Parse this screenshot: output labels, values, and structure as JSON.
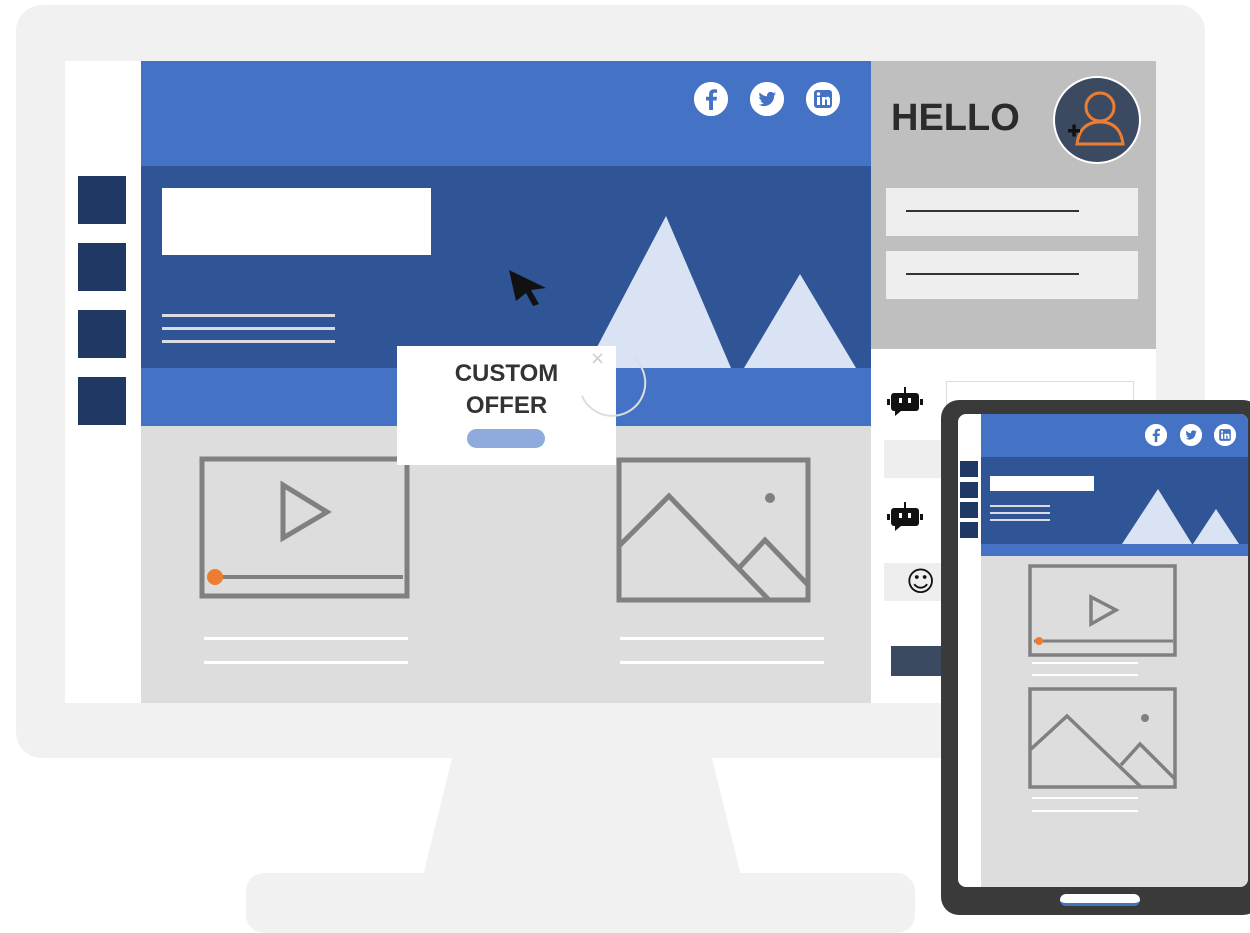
{
  "hero": {
    "social_icons": [
      "facebook-icon",
      "twitter-icon",
      "linkedin-icon"
    ]
  },
  "profile": {
    "greeting": "HELLO",
    "avatar_icon": "user-add-icon"
  },
  "popup": {
    "title": "CUSTOM\nOFFER",
    "close_symbol": "×"
  },
  "chat": {
    "bot_icon": "chatbot-icon",
    "emoji_icon": "smiley-icon",
    "emoji_symbol": "☺"
  },
  "colors": {
    "primary": "#4472c4",
    "dark_primary": "#2f5597",
    "navy": "#1f3864",
    "accent": "#ed7d31",
    "button": "#8faadc"
  }
}
